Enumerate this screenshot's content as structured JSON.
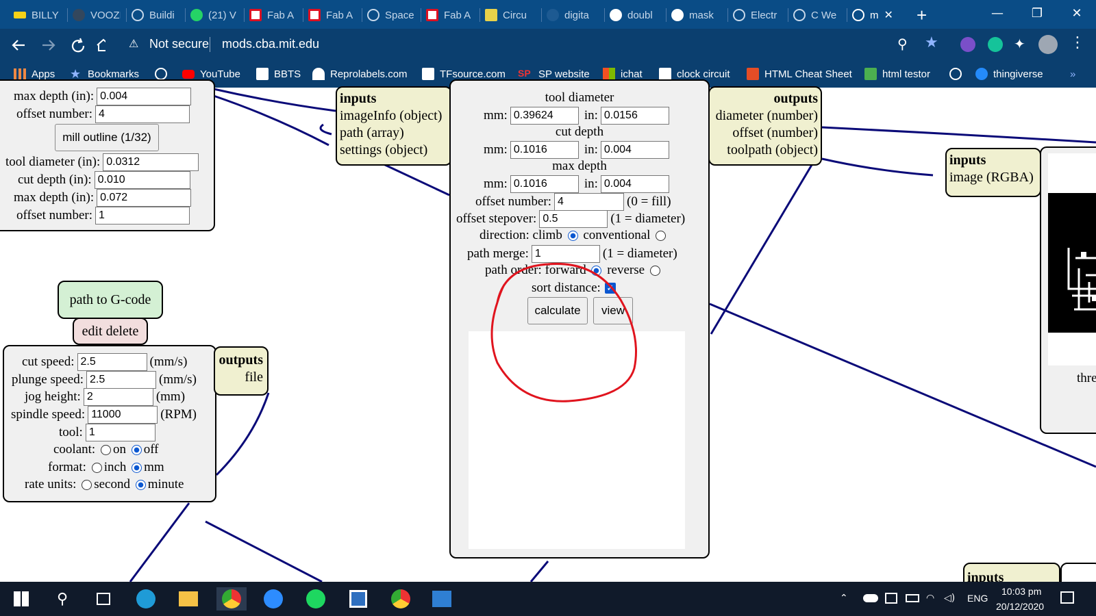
{
  "browser": {
    "tabs": [
      {
        "label": "BILLY",
        "icon": "ikea-icon"
      },
      {
        "label": "VOOZI",
        "icon": "github-icon"
      },
      {
        "label": "Buildi",
        "icon": "globe-icon"
      },
      {
        "label": "(21) V",
        "icon": "whatsapp-icon"
      },
      {
        "label": "Fab A",
        "icon": "fab-icon"
      },
      {
        "label": "Fab A",
        "icon": "fab-icon"
      },
      {
        "label": "Space",
        "icon": "globe-icon"
      },
      {
        "label": "Fab A",
        "icon": "fab-icon"
      },
      {
        "label": "Circu",
        "icon": "circuit-icon"
      },
      {
        "label": "digita",
        "icon": "blank-icon"
      },
      {
        "label": "doubl",
        "icon": "google-icon"
      },
      {
        "label": "mask",
        "icon": "google-icon"
      },
      {
        "label": "Electr",
        "icon": "globe-icon"
      },
      {
        "label": "C We",
        "icon": "globe-icon"
      },
      {
        "label": "m",
        "icon": "globe-icon"
      }
    ],
    "active_tab_close": "✕",
    "new_tab": "+",
    "window_buttons": {
      "minimize": "—",
      "restore": "❐",
      "close": "✕"
    },
    "address": {
      "security": "Not secure",
      "url": "mods.cba.mit.edu"
    },
    "bookmarks": [
      "Apps",
      "Bookmarks",
      "YouTube",
      "BBTS",
      "Reprolabels.com",
      "TFsource.com",
      "SP website",
      "ichat",
      "clock circuit",
      "HTML Cheat Sheet",
      "html testor",
      "thingiverse"
    ],
    "bookmarks_more": "»"
  },
  "left_panel": {
    "rows": [
      {
        "label": "max depth (in):",
        "value": "0.004"
      },
      {
        "label": "offset number:",
        "value": "4"
      }
    ],
    "button": "mill outline (1/32)",
    "rows2": [
      {
        "label": "tool diameter (in):",
        "value": "0.0312"
      },
      {
        "label": "cut depth (in):",
        "value": "0.010"
      },
      {
        "label": "max depth (in):",
        "value": "0.072"
      },
      {
        "label": "offset number:",
        "value": "1"
      }
    ]
  },
  "gcode_module": {
    "title": "path to G-code",
    "edit_delete": "edit delete",
    "cut_speed": {
      "label": "cut speed:",
      "value": "2.5",
      "unit": "(mm/s)"
    },
    "plunge_speed": {
      "label": "plunge speed:",
      "value": "2.5",
      "unit": "(mm/s)"
    },
    "jog_height": {
      "label": "jog height:",
      "value": "2",
      "unit": "(mm)"
    },
    "spindle_speed": {
      "label": "spindle speed:",
      "value": "11000",
      "unit": "(RPM)"
    },
    "tool": {
      "label": "tool:",
      "value": "1"
    },
    "coolant": {
      "label": "coolant:",
      "on": "on",
      "off": "off"
    },
    "format": {
      "label": "format:",
      "inch": "inch",
      "mm": "mm"
    },
    "rate_units": {
      "label": "rate units:",
      "second": "second",
      "minute": "minute"
    },
    "outputs": {
      "title": "outputs",
      "item": "file"
    }
  },
  "inputs_box": {
    "title": "inputs",
    "items": [
      "imageInfo (object)",
      "path (array)",
      "settings (object)"
    ]
  },
  "center_panel": {
    "tool_diameter": {
      "title": "tool diameter",
      "mm": "0.39624",
      "in": "0.0156"
    },
    "cut_depth": {
      "title": "cut depth",
      "mm": "0.1016",
      "in": "0.004"
    },
    "max_depth": {
      "title": "max depth",
      "mm": "0.1016",
      "in": "0.004"
    },
    "mm_label": "mm:",
    "in_label": "in:",
    "offset_number": {
      "label": "offset number:",
      "value": "4",
      "hint": "(0 = fill)"
    },
    "offset_stepover": {
      "label": "offset stepover:",
      "value": "0.5",
      "hint": "(1 = diameter)"
    },
    "direction": {
      "label": "direction: climb",
      "alt": "conventional"
    },
    "path_merge": {
      "label": "path merge:",
      "value": "1",
      "hint": "(1 = diameter)"
    },
    "path_order": {
      "label": "path order: forward",
      "alt": "reverse"
    },
    "sort_distance": {
      "label": "sort distance:"
    },
    "calculate": "calculate",
    "view": "view"
  },
  "outputs_box": {
    "title": "outputs",
    "items": [
      "diameter (number)",
      "offset (number)",
      "toolpath (object)"
    ]
  },
  "image_module": {
    "inputs_title": "inputs",
    "item": "image (RGBA)",
    "footer": "thre"
  },
  "bottom_inputs": "inputs",
  "taskbar": {
    "time": "10:03 pm",
    "date": "20/12/2020",
    "lang": "ENG"
  },
  "colors": {
    "titlebar": "#0a4c86",
    "toolbar": "#0b3f6f",
    "wire": "#0a0a78",
    "annotation": "#e0141e",
    "io_box": "#f0f0d0",
    "module_title": "#d4f0d4",
    "edit_bg": "#f2dede"
  }
}
